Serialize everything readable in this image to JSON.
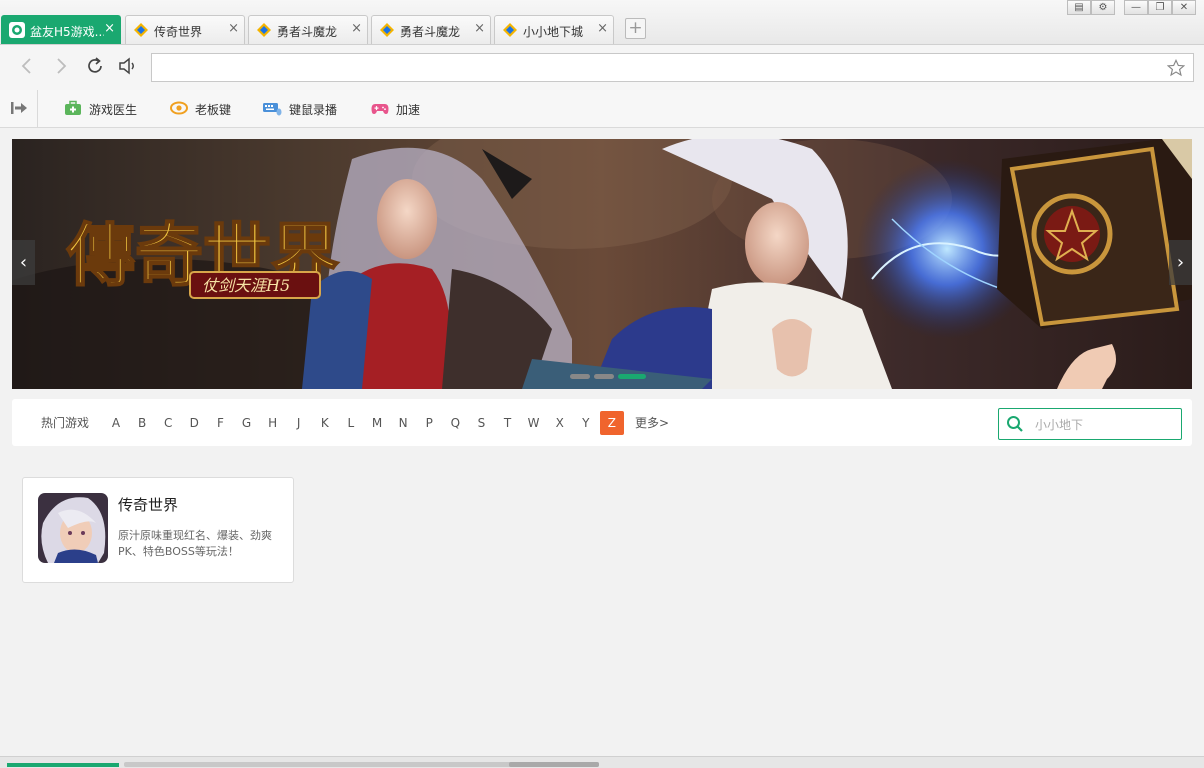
{
  "window": {
    "controls": [
      "▤",
      "⚙",
      "—",
      "❐",
      "✕"
    ]
  },
  "tabs": [
    {
      "label": "盆友H5游戏...",
      "active": true,
      "close": "×"
    },
    {
      "label": "传奇世界",
      "active": false,
      "close": "×"
    },
    {
      "label": "勇者斗魔龙",
      "active": false,
      "close": "×"
    },
    {
      "label": "勇者斗魔龙",
      "active": false,
      "close": "×"
    },
    {
      "label": "小小地下城",
      "active": false,
      "close": "×"
    }
  ],
  "new_tab_label": "+",
  "address_bar": {
    "value": "",
    "placeholder": ""
  },
  "toolbar": {
    "items": [
      {
        "label": "游戏医生",
        "icon": "first-aid-kit-icon"
      },
      {
        "label": "老板键",
        "icon": "eye-icon"
      },
      {
        "label": "键鼠录播",
        "icon": "keyboard-mouse-icon"
      },
      {
        "label": "加速",
        "icon": "gamepad-icon"
      }
    ]
  },
  "banner": {
    "logo_text": "傳奇世界",
    "logo_subtitle": "仗剑天涯H5",
    "prev": "‹",
    "next": "›",
    "slide_count": 3,
    "active_slide": 2
  },
  "filter": {
    "hot_label": "热门游戏",
    "letters": [
      "A",
      "B",
      "C",
      "D",
      "F",
      "G",
      "H",
      "J",
      "K",
      "L",
      "M",
      "N",
      "P",
      "Q",
      "S",
      "T",
      "W",
      "X",
      "Y",
      "Z"
    ],
    "selected": "Z",
    "more_label": "更多>",
    "search_placeholder": "小小地下"
  },
  "games": [
    {
      "title": "传奇世界",
      "description": "原汁原味重现红名、爆装、劲爽PK、特色BOSS等玩法！"
    }
  ],
  "colors": {
    "accent": "#1aa870",
    "selected_letter": "#f0642d"
  }
}
